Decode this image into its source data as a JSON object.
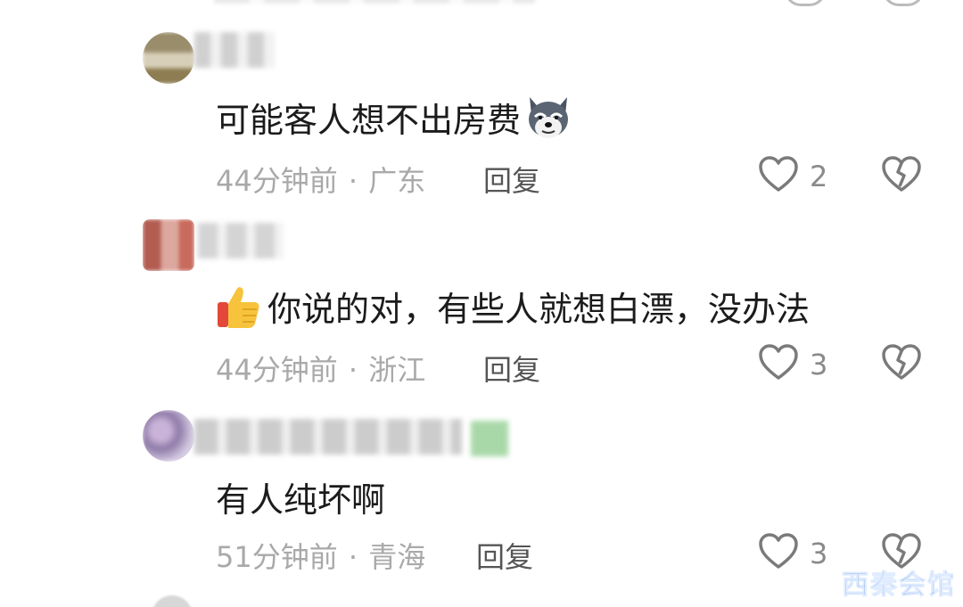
{
  "comments": [
    {
      "text": "可能客人想不出房费",
      "time": "44分钟前",
      "location": "广东",
      "reply_label": "回复",
      "likes": "2",
      "emoji": "wolf-face-emoji"
    },
    {
      "text": "你说的对，有些人就想白漂，没办法",
      "time": "44分钟前",
      "location": "浙江",
      "reply_label": "回复",
      "likes": "3",
      "emoji": "thumbs-up-emoji"
    },
    {
      "text": "有人纯坏啊",
      "time": "51分钟前",
      "location": "青海",
      "reply_label": "回复",
      "likes": "3"
    }
  ],
  "separator": "·",
  "watermark": "西秦会馆",
  "colors": {
    "text": "#1b1b1b",
    "meta": "#a9a9a9",
    "icon": "#7a7a7a",
    "watermark": "#3a7bd5"
  }
}
